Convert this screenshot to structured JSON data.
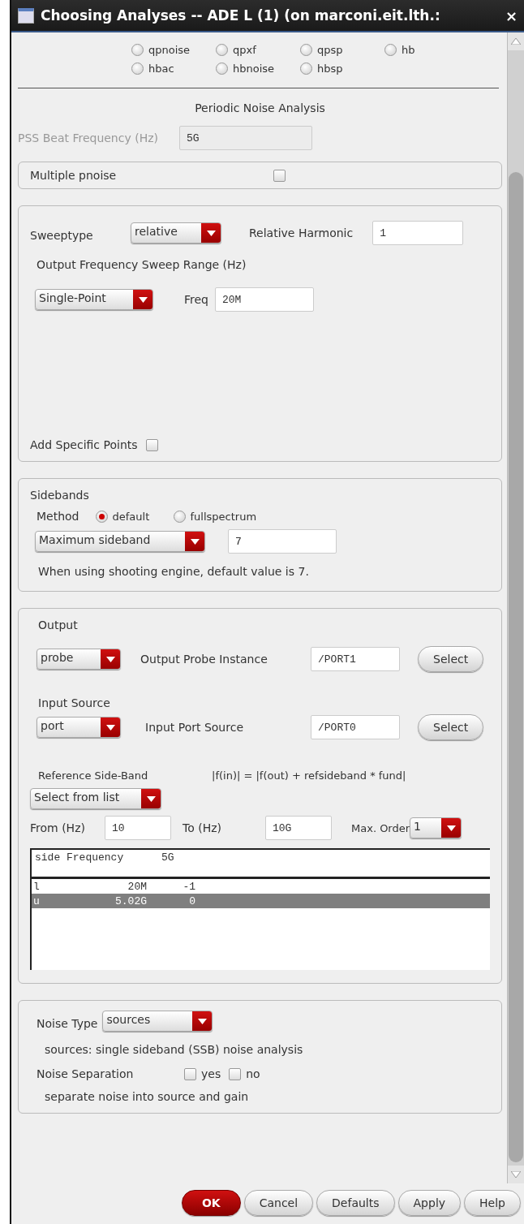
{
  "window": {
    "title": "Choosing Analyses -- ADE L (1) (on marconi.eit.lth.:",
    "close": "×"
  },
  "analysis_radios": [
    [
      {
        "label": "qpnoise",
        "selected": false
      },
      {
        "label": "qpxf",
        "selected": false
      },
      {
        "label": "qpsp",
        "selected": false
      },
      {
        "label": "hb",
        "selected": false
      }
    ],
    [
      {
        "label": "hbac",
        "selected": false
      },
      {
        "label": "hbnoise",
        "selected": false
      },
      {
        "label": "hbsp",
        "selected": false
      }
    ]
  ],
  "section_title": "Periodic Noise Analysis",
  "pss": {
    "label": "PSS Beat Frequency (Hz)",
    "value": "5G",
    "disabled": true
  },
  "multiple_pnoise": {
    "label": "Multiple pnoise",
    "checked": false
  },
  "sweep": {
    "label": "Sweeptype",
    "type": "relative",
    "harmonic_label": "Relative Harmonic",
    "harmonic": "1",
    "range_label": "Output Frequency Sweep Range (Hz)",
    "range_type": "Single-Point",
    "freq_label": "Freq",
    "freq": "20M",
    "specific_label": "Add Specific Points",
    "specific_checked": false
  },
  "sidebands": {
    "title": "Sidebands",
    "method_label": "Method",
    "methods": [
      {
        "label": "default",
        "selected": true
      },
      {
        "label": "fullspectrum",
        "selected": false
      }
    ],
    "mode": "Maximum sideband",
    "value": "7",
    "note": "When using shooting engine, default value is 7."
  },
  "output": {
    "title": "Output",
    "type": "probe",
    "instance_label": "Output Probe Instance",
    "instance": "/PORT1",
    "select": "Select",
    "input_title": "Input Source",
    "input_type": "port",
    "source_label": "Input Port Source",
    "source": "/PORT0",
    "input_select": "Select",
    "ref_label": "Reference Side-Band",
    "formula": "|f(in)| = |f(out) + refsideband * fund|",
    "ref_mode": "Select from list",
    "from_label": "From (Hz)",
    "from": "10",
    "to_label": "To (Hz)",
    "to": "10G",
    "order_label": "Max. Order",
    "order": "1",
    "table_header": "side Frequency      5G",
    "rows": [
      {
        "cells": [
          "l",
          "20M",
          "-1"
        ],
        "selected": false
      },
      {
        "cells": [
          "u",
          "5.02G",
          "0"
        ],
        "selected": true
      }
    ]
  },
  "noise": {
    "type_label": "Noise Type",
    "type": "sources",
    "desc": "sources: single sideband (SSB) noise analysis",
    "sep_label": "Noise Separation",
    "options": [
      {
        "label": "yes",
        "checked": false
      },
      {
        "label": "no",
        "checked": false
      }
    ],
    "sep_desc": "separate noise into source and gain"
  },
  "buttons": [
    {
      "label": "OK",
      "kind": "primary"
    },
    {
      "label": "Cancel",
      "kind": "normal"
    },
    {
      "label": "Defaults",
      "kind": "normal"
    },
    {
      "label": "Apply",
      "kind": "normal"
    },
    {
      "label": "Help",
      "kind": "normal"
    }
  ]
}
